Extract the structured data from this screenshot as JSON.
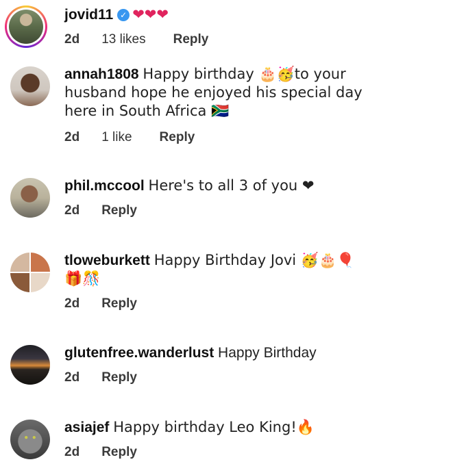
{
  "comments": [
    {
      "username": "jovid11",
      "verified": true,
      "text": "❤❤❤",
      "age": "2d",
      "likes": "13 likes",
      "reply": "Reply"
    },
    {
      "username": "annah1808",
      "text": "Happy birthday 🎂🥳to your husband hope he enjoyed his special day here in South Africa 🇿🇦",
      "age": "2d",
      "likes": "1 like",
      "reply": "Reply"
    },
    {
      "username": "phil.mccool",
      "text": "Here's to all 3 of you ❤",
      "age": "2d",
      "reply": "Reply"
    },
    {
      "username": "tloweburkett",
      "text": "Happy Birthday Jovi 🥳🎂🎈🎁🎊",
      "age": "2d",
      "reply": "Reply"
    },
    {
      "username": "glutenfree.wanderlust",
      "text": "Happy Birthday",
      "age": "2d",
      "reply": "Reply"
    },
    {
      "username": "asiajef",
      "text": "Happy birthday Leo King!🔥",
      "age": "2d",
      "reply": "Reply"
    }
  ],
  "colors": {
    "heart": "#e0245e",
    "verified": "#3897f0",
    "story_ring": [
      "#f9ce34",
      "#ee2a7b",
      "#6228d7"
    ]
  }
}
